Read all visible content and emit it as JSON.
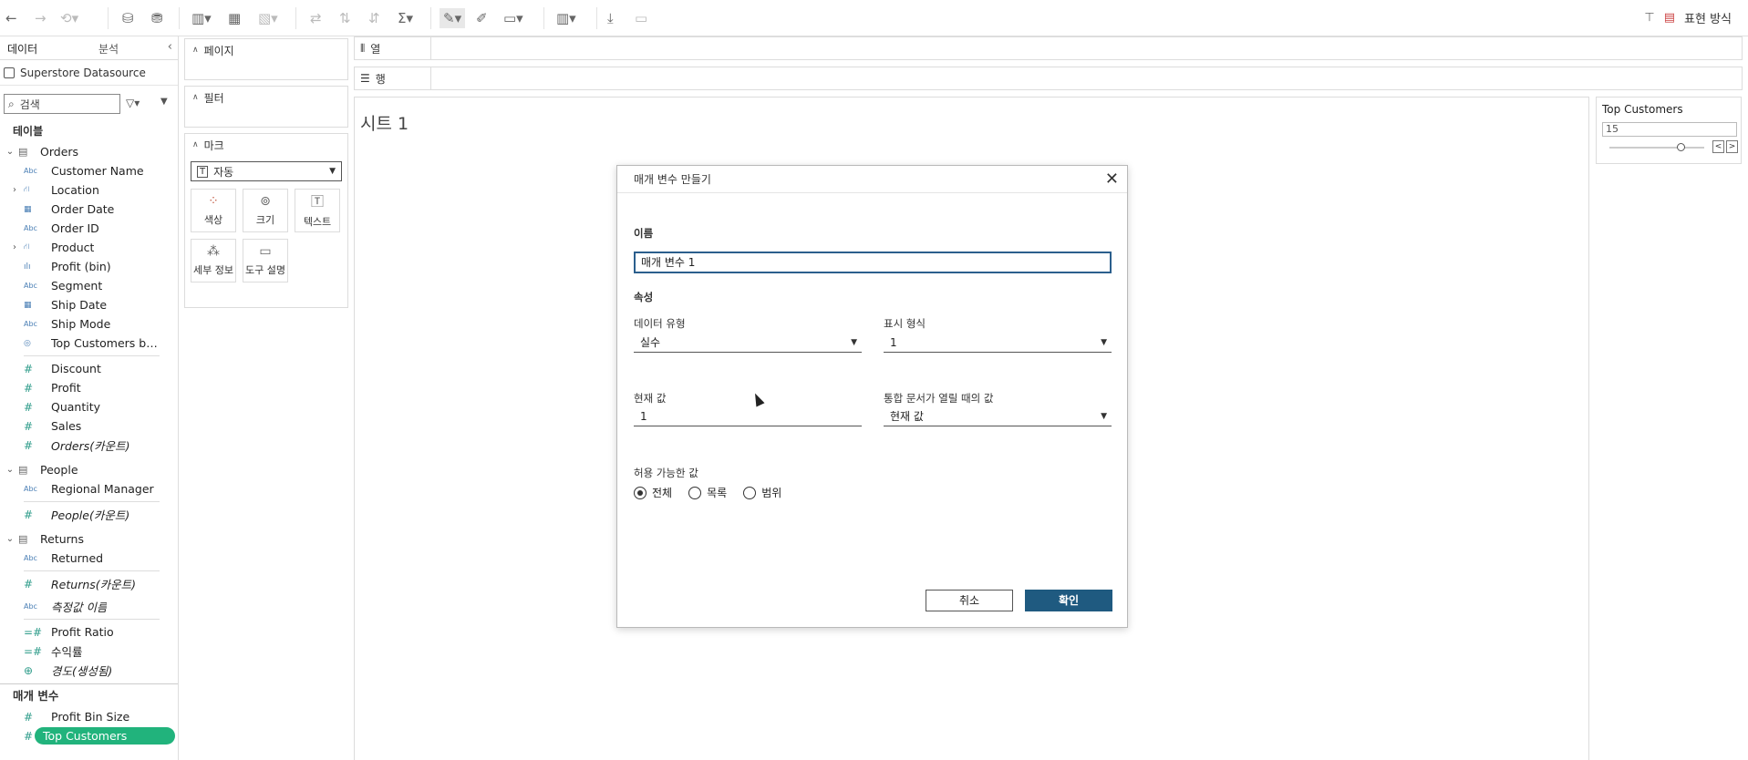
{
  "toolbar": {
    "right_label": "표현 방식",
    "icons": [
      "undo-icon",
      "redo-icon",
      "redo-dropdown-icon",
      "new-datasource-icon",
      "pause-updates-icon",
      "new-worksheet-icon",
      "duplicate-sheet-icon",
      "clear-sheet-icon",
      "swap-rows-columns-icon",
      "sort-ascending-icon",
      "sort-descending-icon",
      "totals-icon",
      "highlight-icon",
      "annotate-icon",
      "fit-icon",
      "show-cards-icon",
      "download-icon",
      "presentation-icon"
    ]
  },
  "left_pane": {
    "tab_data": "데이터",
    "tab_analytics": "분석",
    "datasource": "Superstore Datasource",
    "search_placeholder": "검색",
    "tables_title": "테이블",
    "orders": {
      "name": "Orders",
      "fields": [
        {
          "type": "Abc",
          "name": "Customer Name"
        },
        {
          "type": "hier",
          "name": "Location"
        },
        {
          "type": "date",
          "name": "Order Date"
        },
        {
          "type": "Abc",
          "name": "Order ID"
        },
        {
          "type": "hier",
          "name": "Product"
        },
        {
          "type": "bin",
          "name": "Profit (bin)"
        },
        {
          "type": "Abc",
          "name": "Segment"
        },
        {
          "type": "date",
          "name": "Ship Date"
        },
        {
          "type": "Abc",
          "name": "Ship Mode"
        },
        {
          "type": "set",
          "name": "Top Customers by ..."
        },
        {
          "type": "#",
          "name": "Discount"
        },
        {
          "type": "#",
          "name": "Profit"
        },
        {
          "type": "#",
          "name": "Quantity"
        },
        {
          "type": "#",
          "name": "Sales"
        },
        {
          "type": "#",
          "name": "Orders(카운트)"
        }
      ]
    },
    "people": {
      "name": "People",
      "fields": [
        {
          "type": "Abc",
          "name": "Regional Manager"
        },
        {
          "type": "#",
          "name": "People(카운트)"
        }
      ]
    },
    "returns": {
      "name": "Returns",
      "fields": [
        {
          "type": "Abc",
          "name": "Returned"
        },
        {
          "type": "#",
          "name": "Returns(카운트)"
        }
      ]
    },
    "extra": [
      {
        "type": "Abc",
        "name": "측정값 이름"
      },
      {
        "type": "calc",
        "name": "Profit Ratio"
      },
      {
        "type": "calc",
        "name": "수익률"
      },
      {
        "type": "geo",
        "name": "경도(생성됨)"
      }
    ],
    "parameters_title": "매개 변수",
    "parameters": [
      "Profit Bin Size",
      "Top Customers"
    ]
  },
  "shelves": {
    "pages": "페이지",
    "filters": "필터",
    "marks": "마크",
    "marks_type": "자동",
    "mark_buttons": [
      "색상",
      "크기",
      "텍스트",
      "세부 정보",
      "도구 설명"
    ],
    "columns": "열",
    "rows": "행"
  },
  "sheet": {
    "title": "시트 1"
  },
  "param_control": {
    "title": "Top Customers",
    "value": "15",
    "slider_fraction": 0.75
  },
  "dialog": {
    "title": "매개 변수 만들기",
    "name_label": "이름",
    "name_value": "매개 변수 1",
    "properties_label": "속성",
    "data_type_label": "데이터 유형",
    "data_type_value": "실수",
    "display_format_label": "표시 형식",
    "display_format_value": "1",
    "current_value_label": "현재 값",
    "current_value": "1",
    "workbook_open_label": "통합 문서가 열릴 때의 값",
    "workbook_open_value": "현재 값",
    "allowable_label": "허용 가능한 값",
    "radio_all": "전체",
    "radio_list": "목록",
    "radio_range": "범위",
    "cancel": "취소",
    "ok": "확인"
  },
  "colors": {
    "accent": "#1f5a80",
    "selected_pill": "#21b37c",
    "measure": "#2e9c8a",
    "dimension": "#4a7fb5"
  }
}
